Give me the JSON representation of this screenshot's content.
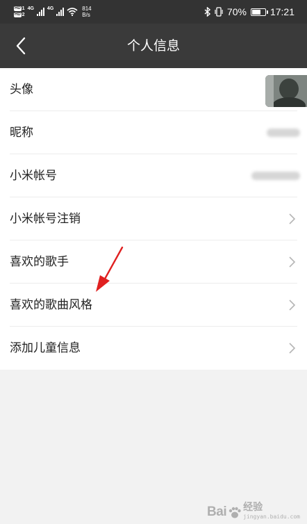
{
  "status_bar": {
    "hd_label": "HD",
    "sim1": "1",
    "sim2": "2",
    "network_type_1": "4G",
    "network_type_2": "4G",
    "net_speed_value": "814",
    "net_speed_unit": "B/s",
    "battery_percent": "70%",
    "battery_level": 0.7,
    "time": "17:21"
  },
  "navbar": {
    "title": "个人信息"
  },
  "rows": [
    {
      "label": "头像"
    },
    {
      "label": "昵称"
    },
    {
      "label": "小米帐号"
    },
    {
      "label": "小米帐号注销"
    },
    {
      "label": "喜欢的歌手"
    },
    {
      "label": "喜欢的歌曲风格"
    },
    {
      "label": "添加儿童信息"
    }
  ],
  "colors": {
    "statusbar_bg": "#333333",
    "navbar_bg": "#3a3a3a",
    "page_bg": "#f2f2f2",
    "annotation_arrow": "#e02020"
  },
  "watermark": {
    "brand": "Bai",
    "brand_suffix": "经验",
    "url": "jingyan.baidu.com"
  }
}
